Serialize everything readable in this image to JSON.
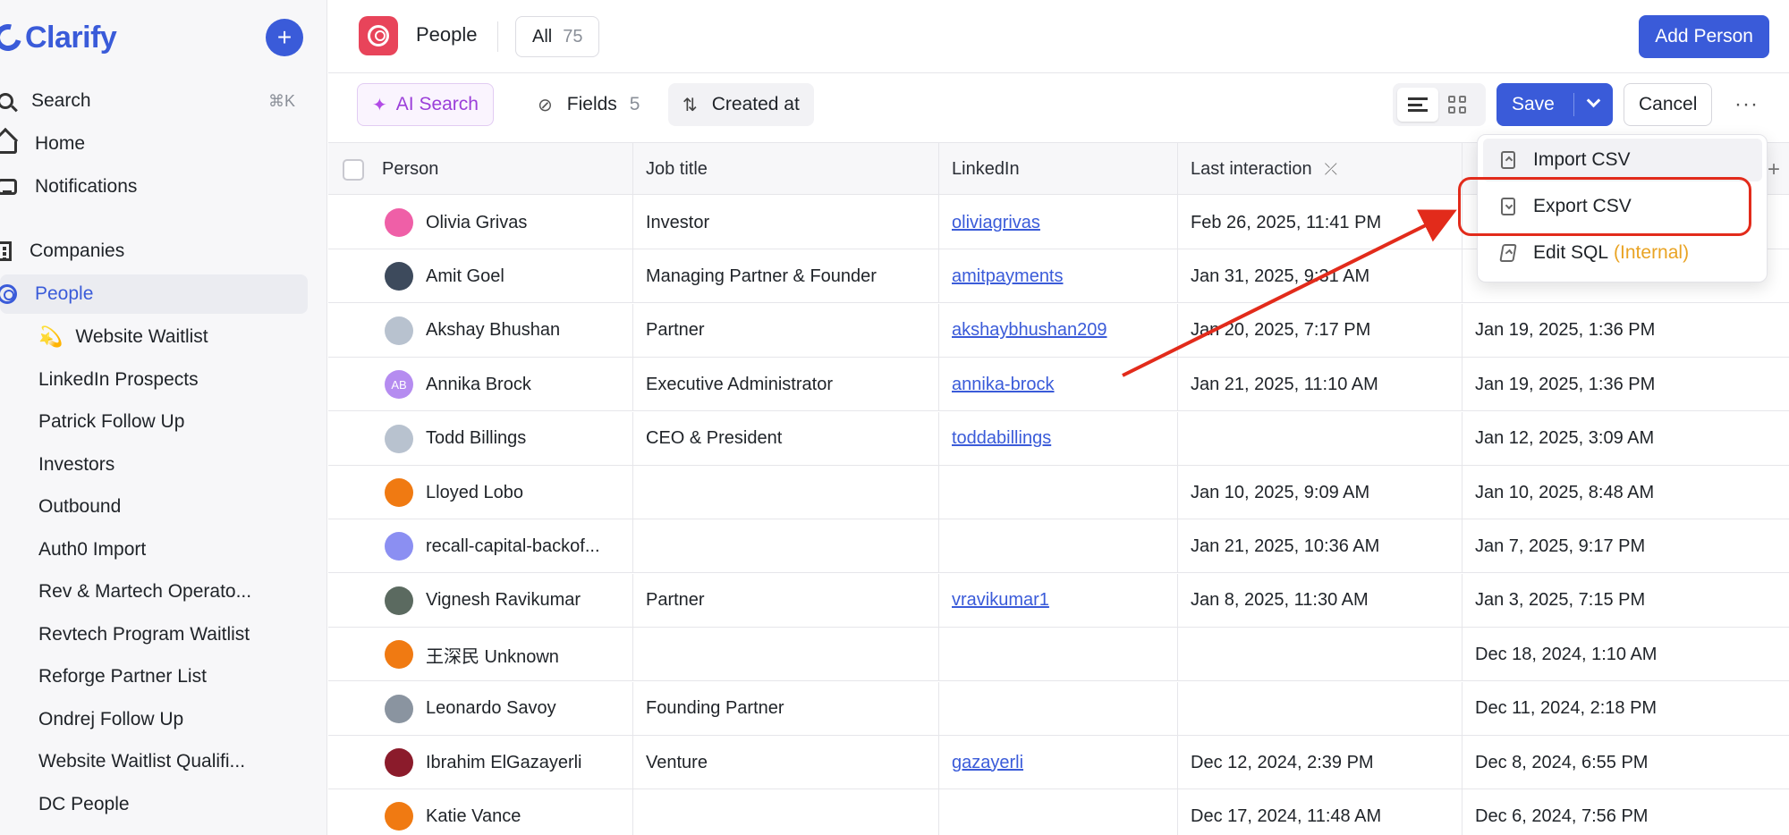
{
  "sidebar": {
    "logo": "Clarify",
    "add_label": "+",
    "nav": [
      {
        "label": "Search",
        "kbd": "⌘K",
        "icon": "search-icon"
      },
      {
        "label": "Home",
        "icon": "home-icon"
      },
      {
        "label": "Notifications",
        "icon": "inbox-icon"
      },
      {
        "label": "Companies",
        "icon": "building-icon"
      },
      {
        "label": "People",
        "icon": "person-icon"
      }
    ],
    "lists": [
      {
        "label": "Website Waitlist",
        "emoji": "💫"
      },
      {
        "label": "LinkedIn Prospects"
      },
      {
        "label": "Patrick Follow Up"
      },
      {
        "label": "Investors"
      },
      {
        "label": "Outbound"
      },
      {
        "label": "Auth0 Import"
      },
      {
        "label": "Rev & Martech Operato..."
      },
      {
        "label": "Revtech Program Waitlist"
      },
      {
        "label": "Reforge Partner List"
      },
      {
        "label": "Ondrej Follow Up"
      },
      {
        "label": "Website Waitlist Qualifi..."
      },
      {
        "label": "DC People"
      }
    ]
  },
  "header": {
    "title": "People",
    "tab_label": "All",
    "tab_count": "75",
    "add_person": "Add Person"
  },
  "toolbar": {
    "ai_search": "AI Search",
    "fields": "Fields",
    "fields_count": "5",
    "sort": "Created at",
    "save": "Save",
    "cancel": "Cancel",
    "more": "···"
  },
  "table": {
    "headers": [
      "Person",
      "Job title",
      "LinkedIn",
      "Last interaction",
      ""
    ],
    "rows": [
      {
        "person": "Olivia Grivas",
        "avatar_color": "#ef5fa7",
        "job": "Investor",
        "linkedin": "oliviagrivas",
        "last": "Feb 26, 2025, 11:41 PM",
        "created": ""
      },
      {
        "person": "Amit Goel",
        "avatar_color": "#3d4a5c",
        "job": "Managing Partner & Founder",
        "linkedin": "amitpayments",
        "last": "Jan 31, 2025, 9:31 AM",
        "created": ""
      },
      {
        "person": "Akshay Bhushan",
        "avatar_color": "#b8c2cf",
        "job": "Partner",
        "linkedin": "akshaybhushan209",
        "last": "Jan 20, 2025, 7:17 PM",
        "created": "Jan 19, 2025, 1:36 PM"
      },
      {
        "person": "Annika Brock",
        "avatar_color": "#b58cf0",
        "avatar_initials": "AB",
        "job": "Executive Administrator",
        "linkedin": "annika-brock",
        "last": "Jan 21, 2025, 11:10 AM",
        "created": "Jan 19, 2025, 1:36 PM"
      },
      {
        "person": "Todd Billings",
        "avatar_color": "#b8c2cf",
        "job": "CEO & President",
        "linkedin": "toddabillings",
        "last": "",
        "created": "Jan 12, 2025, 3:09 AM"
      },
      {
        "person": "Lloyed Lobo",
        "avatar_color": "#f07a12",
        "job": "",
        "linkedin": "",
        "last": "Jan 10, 2025, 9:09 AM",
        "created": "Jan 10, 2025, 8:48 AM"
      },
      {
        "person": "recall-capital-backof...",
        "avatar_color": "#8b8ff2",
        "job": "",
        "linkedin": "",
        "last": "Jan 21, 2025, 10:36 AM",
        "created": "Jan 7, 2025, 9:17 PM"
      },
      {
        "person": "Vignesh Ravikumar",
        "avatar_color": "#5b6a60",
        "job": "Partner",
        "linkedin": "vravikumar1",
        "last": "Jan 8, 2025, 11:30 AM",
        "created": "Jan 3, 2025, 7:15 PM"
      },
      {
        "person": "王深民 Unknown",
        "avatar_color": "#f07a12",
        "job": "",
        "linkedin": "",
        "last": "",
        "created": "Dec 18, 2024, 1:10 AM"
      },
      {
        "person": "Leonardo Savoy",
        "avatar_color": "#8a94a0",
        "job": "Founding Partner",
        "linkedin": "",
        "last": "",
        "created": "Dec 11, 2024, 2:18 PM"
      },
      {
        "person": "Ibrahim ElGazayerli",
        "avatar_color": "#8b1b2b",
        "job": "Venture",
        "linkedin": "gazayerli",
        "last": "Dec 12, 2024, 2:39 PM",
        "created": "Dec 8, 2024, 6:55 PM"
      },
      {
        "person": "Katie Vance",
        "avatar_color": "#f07a12",
        "job": "",
        "linkedin": "",
        "last": "Dec 17, 2024, 11:48 AM",
        "created": "Dec 6, 2024, 7:56 PM"
      }
    ]
  },
  "dropdown": {
    "items": [
      {
        "label": "Import CSV",
        "icon": "upload-file-icon"
      },
      {
        "label": "Export CSV",
        "icon": "download-file-icon"
      },
      {
        "label": "Edit SQL",
        "suffix": "(Internal)",
        "icon": "edit-sql-icon"
      }
    ]
  },
  "colors": {
    "accent": "#3a5bd9",
    "annotation": "#e22b1b"
  }
}
